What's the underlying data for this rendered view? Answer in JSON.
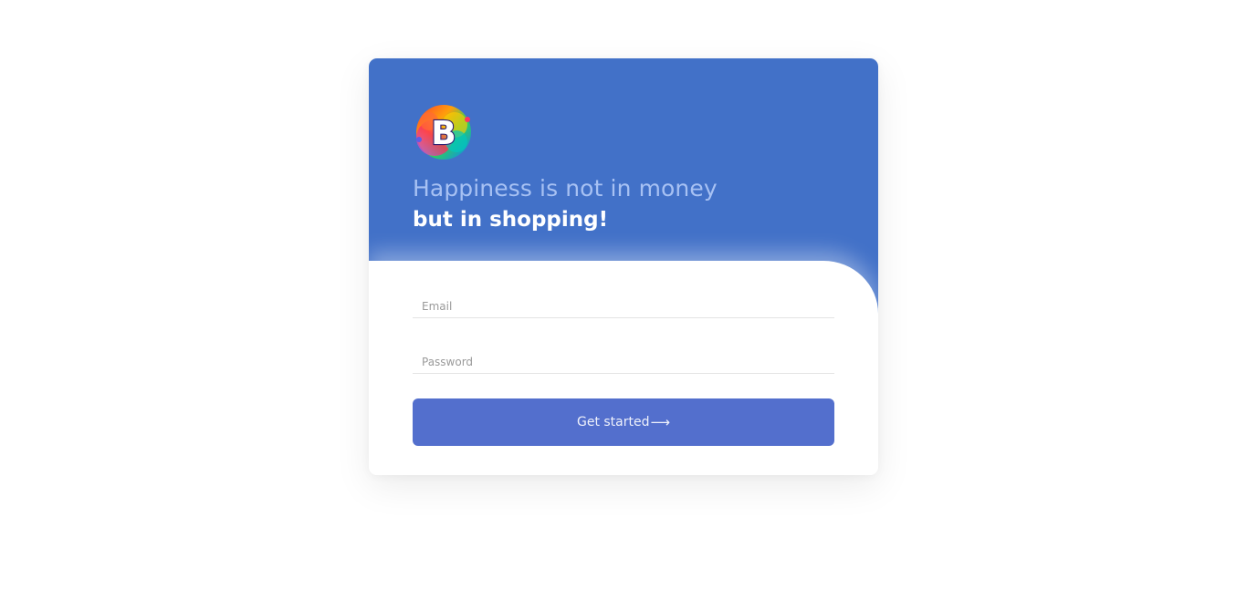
{
  "header": {
    "logo_letter": "B",
    "tagline_line1": "Happiness is not in money",
    "tagline_line2": "but in shopping!"
  },
  "form": {
    "email_placeholder": "Email",
    "email_value": "",
    "password_placeholder": "Password",
    "password_value": "",
    "submit_label": "Get started",
    "submit_icon": "arrow-right-icon",
    "submit_icon_glyph": "⟶"
  },
  "colors": {
    "header_bg": "#4271c8",
    "tagline_light": "#a7c1f3",
    "button_bg": "#536fcd",
    "page_bg": "#ffffff"
  }
}
